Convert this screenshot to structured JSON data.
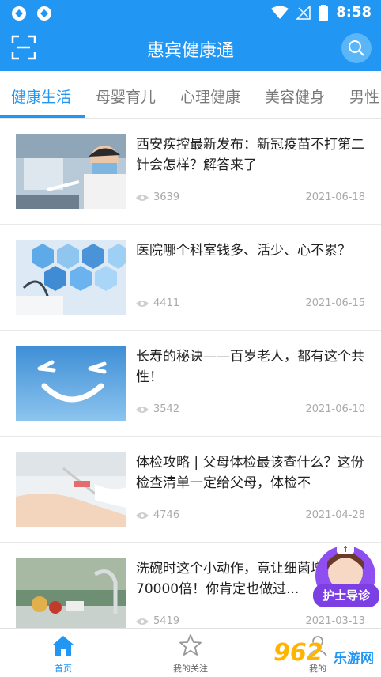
{
  "status_bar": {
    "time": "8:58"
  },
  "header": {
    "title": "惠宾健康通"
  },
  "tabs": [
    {
      "label": "健康生活",
      "active": true
    },
    {
      "label": "母婴育儿",
      "active": false
    },
    {
      "label": "心理健康",
      "active": false
    },
    {
      "label": "美容健身",
      "active": false
    },
    {
      "label": "男性",
      "active": false
    }
  ],
  "articles": [
    {
      "title": "西安疾控最新发布：新冠疫苗不打第二针会怎样？解答来了",
      "views": "3639",
      "date": "2021-06-18"
    },
    {
      "title": "医院哪个科室钱多、活少、心不累？",
      "views": "4411",
      "date": "2021-06-15"
    },
    {
      "title": "长寿的秘诀——百岁老人，都有这个共性！",
      "views": "3542",
      "date": "2021-06-10"
    },
    {
      "title": "体检攻略 | 父母体检最该查什么？这份检查清单一定给父母，体检不",
      "views": "4746",
      "date": "2021-04-28"
    },
    {
      "title": "洗碗时这个小动作，竟让细菌增加70000倍！你肯定也做过...",
      "views": "5419",
      "date": "2021-03-13"
    }
  ],
  "bottom_nav": [
    {
      "label": "首页",
      "icon": "home-icon",
      "active": true
    },
    {
      "label": "我的关注",
      "icon": "star-icon",
      "active": false
    },
    {
      "label": "我的",
      "icon": "user-icon",
      "active": false
    }
  ],
  "watermark": {
    "bubble": "护士导诊",
    "number": "962",
    "site": "乐游网"
  },
  "colors": {
    "primary": "#2196f3",
    "text": "#222222",
    "meta": "#aaaaaa"
  }
}
